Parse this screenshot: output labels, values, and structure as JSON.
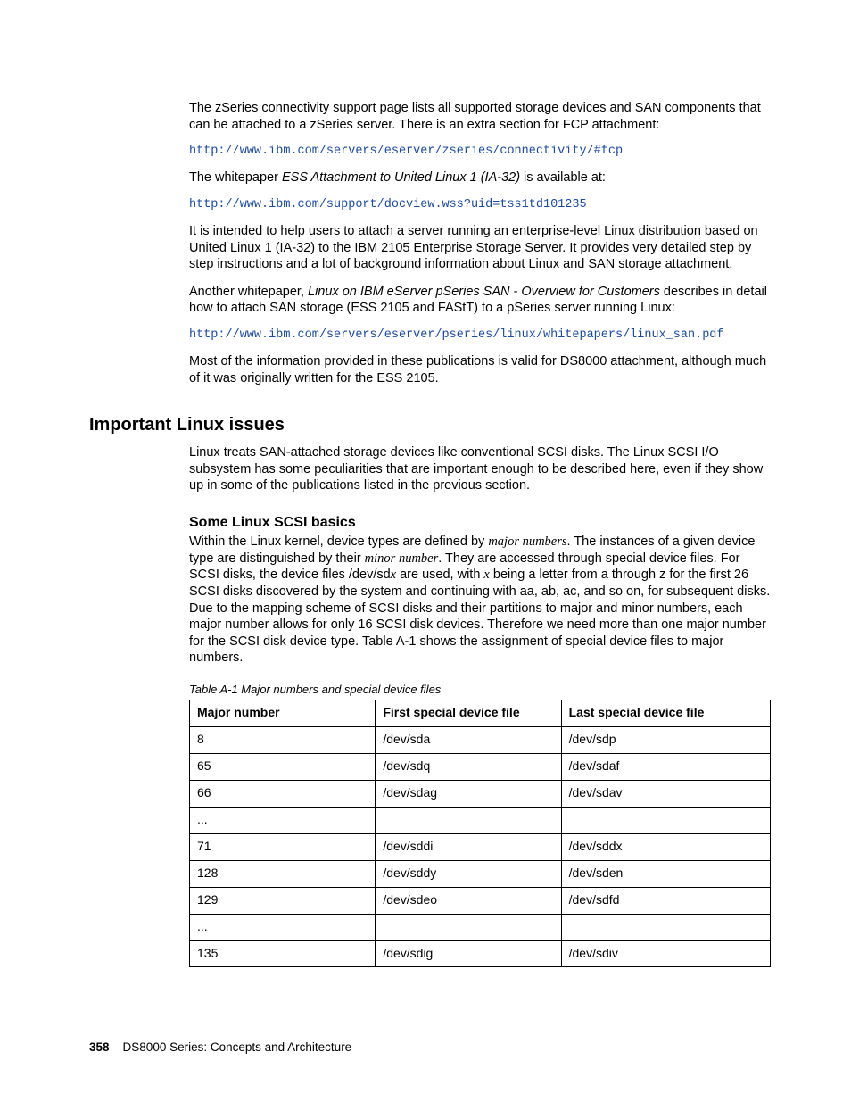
{
  "paragraphs": {
    "p1": "The zSeries connectivity support page lists all supported storage devices and SAN components that can be attached to a zSeries server. There is an extra section for FCP attachment:",
    "link1": "http://www.ibm.com/servers/eserver/zseries/connectivity/#fcp",
    "p2a": "The whitepaper ",
    "p2b": "ESS Attachment to United Linux 1 (IA-32)",
    "p2c": " is available at:",
    "link2": "http://www.ibm.com/support/docview.wss?uid=tss1td101235",
    "p3": "It is intended to help users to attach a server running an enterprise-level Linux distribution based on United Linux 1 (IA-32) to the IBM 2105 Enterprise Storage Server. It provides very detailed step by step instructions and a lot of background information about Linux and SAN storage attachment.",
    "p4a": "Another whitepaper, ",
    "p4b": "Linux on IBM eServer pSeries SAN - Overview for Customers",
    "p4c": " describes in detail how to attach SAN storage (ESS 2105 and FAStT) to a pSeries server running Linux:",
    "link3": "http://www.ibm.com/servers/eserver/pseries/linux/whitepapers/linux_san.pdf",
    "p5": "Most of the information provided in these publications is valid for DS8000 attachment, although much of it was originally written for the ESS 2105."
  },
  "headings": {
    "h2": "Important Linux issues",
    "h3": "Some Linux SCSI basics"
  },
  "section": {
    "intro": "Linux treats SAN-attached storage devices like conventional SCSI disks. The Linux SCSI I/O subsystem has some peculiarities that are important enough to be described here, even if they show up in some of the publications listed in the previous section.",
    "scsi_a": "Within the Linux kernel, device types are defined by ",
    "scsi_major": "major numbers",
    "scsi_b": ". The instances of a given device type are distinguished by their ",
    "scsi_minor": "minor number",
    "scsi_c": ". They are accessed through special device files. For SCSI disks, the device files /dev/sd",
    "scsi_x1": "x",
    "scsi_d": " are used, with ",
    "scsi_x2": "x",
    "scsi_e": " being a letter from a through z for the first 26 SCSI disks discovered by the system and continuing with aa, ab, ac, and so on, for subsequent disks. Due to the mapping scheme of SCSI disks and their partitions to major and minor numbers, each major number allows for only 16 SCSI disk devices. Therefore we need more than one major number for the SCSI disk device type. Table A-1 shows the assignment of special device files to major numbers."
  },
  "table": {
    "caption": "Table A-1   Major numbers and special device files",
    "headers": [
      "Major number",
      "First special device file",
      "Last special device file"
    ],
    "rows": [
      [
        "8",
        "/dev/sda",
        "/dev/sdp"
      ],
      [
        "65",
        "/dev/sdq",
        "/dev/sdaf"
      ],
      [
        "66",
        "/dev/sdag",
        "/dev/sdav"
      ],
      [
        "...",
        "",
        ""
      ],
      [
        "71",
        "/dev/sddi",
        "/dev/sddx"
      ],
      [
        "128",
        "/dev/sddy",
        "/dev/sden"
      ],
      [
        "129",
        "/dev/sdeo",
        "/dev/sdfd"
      ],
      [
        "...",
        "",
        ""
      ],
      [
        "135",
        "/dev/sdig",
        "/dev/sdiv"
      ]
    ]
  },
  "footer": {
    "page": "358",
    "title": "DS8000 Series: Concepts and Architecture"
  }
}
